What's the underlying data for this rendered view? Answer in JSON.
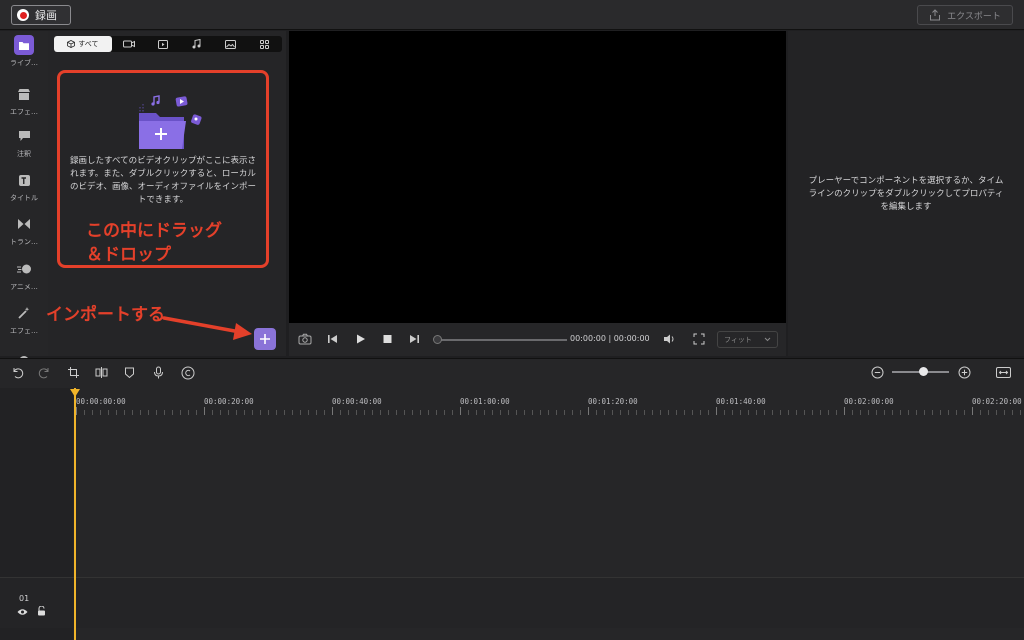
{
  "header": {
    "record_label": "録画",
    "export_label": "エクスポート"
  },
  "rail": {
    "items": [
      {
        "label": "ライブ…",
        "icon": "folder-icon"
      },
      {
        "label": "エフェ…",
        "icon": "store-icon"
      },
      {
        "label": "注釈",
        "icon": "comment-icon"
      },
      {
        "label": "タイトル",
        "icon": "title-icon"
      },
      {
        "label": "トラン…",
        "icon": "transition-icon"
      },
      {
        "label": "アニメ…",
        "icon": "animation-icon"
      },
      {
        "label": "エフェ…",
        "icon": "magic-wand-icon"
      }
    ]
  },
  "media": {
    "tab_all": "すべて",
    "drop_text": "録画したすべてのビデオクリップがここに表示されます。また、ダブルクリックすると、ローカルのビデオ、画像、オーディオファイルをインポートできます。"
  },
  "annotations": {
    "drag_drop_line1": "この中にドラッグ",
    "drag_drop_line2": "＆ドロップ",
    "import": "インポートする"
  },
  "player": {
    "timecode": "00:00:00 | 00:00:00",
    "fit_label": "フィット"
  },
  "properties": {
    "message": "プレーヤーでコンポーネントを選択するか、タイムラインのクリップをダブルクリックしてプロパティを編集します"
  },
  "timeline": {
    "ruler_labels": [
      "00:00:00:00",
      "00:00:20:00",
      "00:00:40:00",
      "00:01:00:00",
      "00:01:20:00",
      "00:01:40:00",
      "00:02:00:00",
      "00:02:20:00"
    ],
    "track_number": "01"
  },
  "colors": {
    "accent": "#7b5bd6",
    "annotation": "#e4402a",
    "playhead": "#f0b42a"
  }
}
